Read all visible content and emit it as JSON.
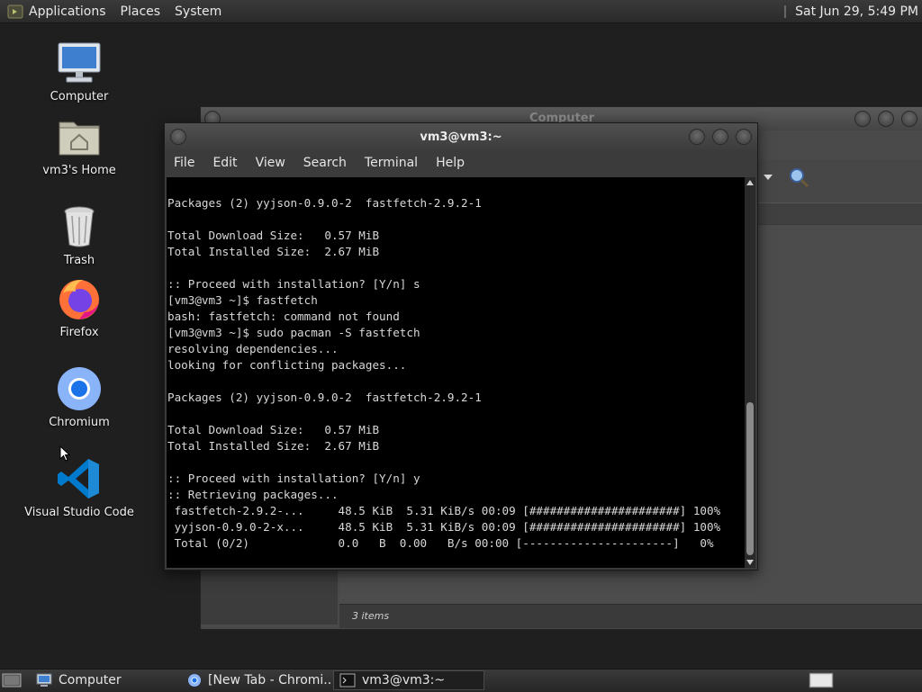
{
  "top_panel": {
    "menus": [
      "Applications",
      "Places",
      "System"
    ],
    "clock": "Sat Jun 29,  5:49 PM"
  },
  "desktop": {
    "icons": [
      {
        "label": "Computer",
        "icon": "computer-icon"
      },
      {
        "label": "vm3's Home",
        "icon": "home-folder-icon"
      },
      {
        "label": "Trash",
        "icon": "trash-icon"
      },
      {
        "label": "Firefox",
        "icon": "firefox-icon"
      },
      {
        "label": "Chromium",
        "icon": "chromium-icon"
      },
      {
        "label": "Visual Studio Code",
        "icon": "vscode-icon"
      }
    ]
  },
  "file_manager": {
    "title": "Computer",
    "status": "3 items"
  },
  "terminal": {
    "title": "vm3@vm3:~",
    "menu": [
      "File",
      "Edit",
      "View",
      "Search",
      "Terminal",
      "Help"
    ],
    "lines": [
      "Packages (2) yyjson-0.9.0-2  fastfetch-2.9.2-1",
      "",
      "Total Download Size:   0.57 MiB",
      "Total Installed Size:  2.67 MiB",
      "",
      ":: Proceed with installation? [Y/n] s",
      "[vm3@vm3 ~]$ fastfetch",
      "bash: fastfetch: command not found",
      "[vm3@vm3 ~]$ sudo pacman -S fastfetch",
      "resolving dependencies...",
      "looking for conflicting packages...",
      "",
      "Packages (2) yyjson-0.9.0-2  fastfetch-2.9.2-1",
      "",
      "Total Download Size:   0.57 MiB",
      "Total Installed Size:  2.67 MiB",
      "",
      ":: Proceed with installation? [Y/n] y",
      ":: Retrieving packages...",
      " fastfetch-2.9.2-...     48.5 KiB  5.31 KiB/s 00:09 [######################] 100%",
      " yyjson-0.9.0-2-x...     48.5 KiB  5.31 KiB/s 00:09 [######################] 100%",
      " Total (0/2)             0.0   B  0.00   B/s 00:00 [----------------------]   0%"
    ]
  },
  "taskbar": {
    "tasks": [
      {
        "label": "Computer",
        "icon": "file-manager-icon"
      },
      {
        "label": "[New Tab - Chromi...",
        "icon": "chromium-icon"
      },
      {
        "label": "vm3@vm3:~",
        "icon": "terminal-icon"
      }
    ]
  },
  "colors": {
    "desktop_bg": "#1f1f1f",
    "terminal_bg": "#000000",
    "terminal_fg": "#d8d8d8",
    "panel_bg": "#2e2e2e"
  }
}
